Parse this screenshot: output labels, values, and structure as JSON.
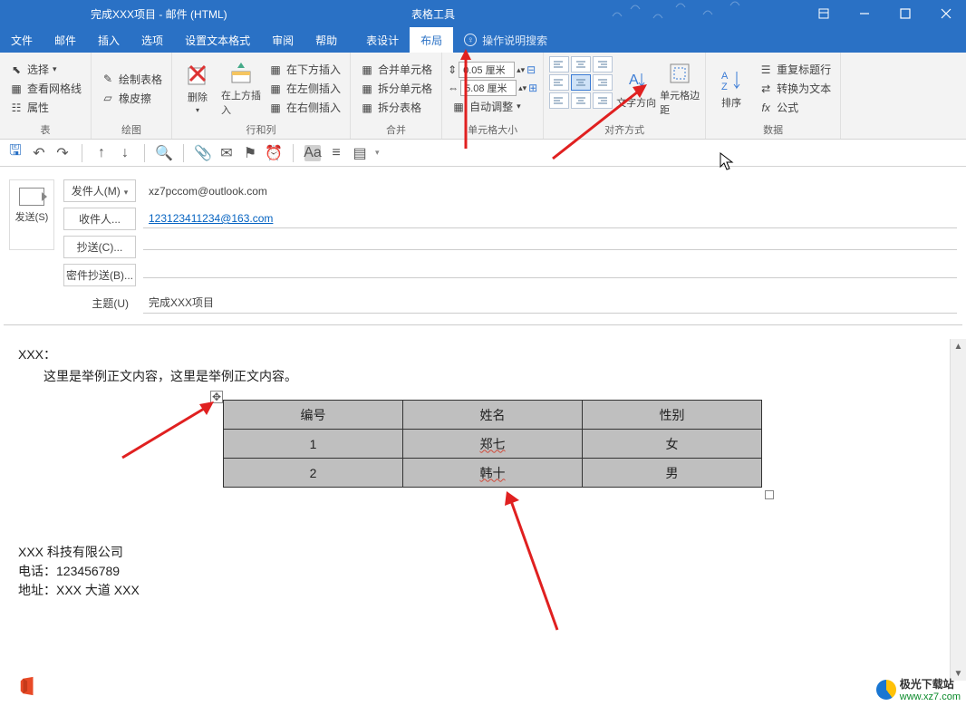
{
  "titlebar": {
    "title": "完成XXX项目  -  邮件 (HTML)",
    "tabletools": "表格工具"
  },
  "menu": {
    "file": "文件",
    "mail": "邮件",
    "insert": "插入",
    "options": "选项",
    "format": "设置文本格式",
    "review": "审阅",
    "help": "帮助",
    "tdesign": "表设计",
    "layout": "布局",
    "tell": "操作说明搜索"
  },
  "ribbon": {
    "g1": {
      "select": "选择",
      "gridlines": "查看网格线",
      "props": "属性",
      "label": "表"
    },
    "g2": {
      "draw": "绘制表格",
      "eraser": "橡皮擦",
      "label": "绘图"
    },
    "g3": {
      "delete": "删除",
      "insabove": "在上方插入",
      "insbelow": "在下方插入",
      "insleft": "在左侧插入",
      "insright": "在右侧插入",
      "label": "行和列"
    },
    "g4": {
      "merge": "合并单元格",
      "split": "拆分单元格",
      "splittbl": "拆分表格",
      "label": "合并"
    },
    "g5": {
      "h": "0.05 厘米",
      "w": "5.08 厘米",
      "autofit": "自动调整",
      "label": "单元格大小"
    },
    "g6": {
      "textdir": "文字方向",
      "margins": "单元格边距",
      "label": "对齐方式"
    },
    "g7": {
      "sort": "排序",
      "repeat": "重复标题行",
      "convert": "转换为文本",
      "formula": "公式",
      "label": "数据"
    }
  },
  "compose": {
    "send": "发送(S)",
    "from_label": "发件人(M)",
    "from_value": "xz7pccom@outlook.com",
    "to_label": "收件人...",
    "to_value": "123123411234@163.com",
    "cc_label": "抄送(C)...",
    "bcc_label": "密件抄送(B)...",
    "subject_label": "主题(U)",
    "subject_value": "完成XXX项目"
  },
  "body": {
    "greeting": "XXX：",
    "para1": "这里是举例正文内容，这里是举例正文内容。",
    "table": {
      "headers": [
        "编号",
        "姓名",
        "性别"
      ],
      "rows": [
        [
          "1",
          "郑七",
          "女"
        ],
        [
          "2",
          "韩十",
          "男"
        ]
      ]
    },
    "sig_company": "XXX 科技有限公司",
    "sig_tel": "电话：123456789",
    "sig_addr": "地址：XXX 大道 XXX"
  },
  "watermark": {
    "name": "极光下载站",
    "url": "www.xz7.com"
  }
}
